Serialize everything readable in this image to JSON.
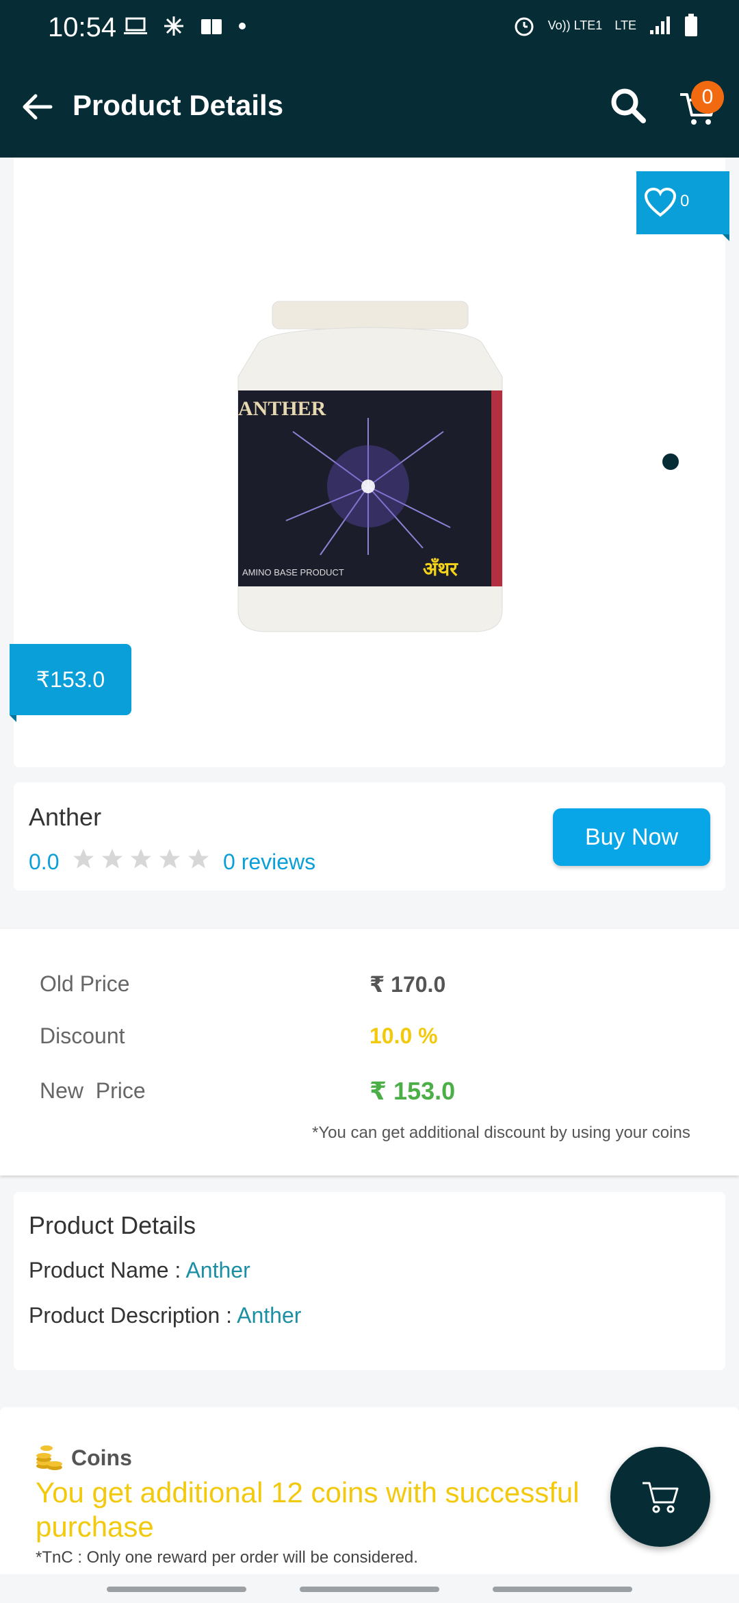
{
  "status_bar": {
    "time": "10:54",
    "network": "Vo)) LTE1",
    "network2": "LTE"
  },
  "app_bar": {
    "title": "Product Details",
    "cart_count": "0"
  },
  "product": {
    "wishlist_count": "0",
    "price_tag": "₹153.0",
    "name": "Anther",
    "rating": "0.0",
    "reviews": "0 reviews",
    "buy_now": "Buy Now",
    "image_label": "ANTHER",
    "image_sub": "AMINO BASE PRODUCT",
    "image_hindi": "अँथर"
  },
  "pricing": {
    "old_price_label": "Old Price",
    "old_price": "₹ 170.0",
    "discount_label": "Discount",
    "discount": "10.0 %",
    "new_price_label": "New  Price",
    "new_price": "₹ 153.0",
    "note": "*You can get additional discount by using your coins"
  },
  "details": {
    "title": "Product Details",
    "name_label": "Product Name : ",
    "name_value": "Anther",
    "desc_label": "Product Description : ",
    "desc_value": "Anther"
  },
  "coins": {
    "title": "Coins",
    "message": "You get additional 12 coins with successful purchase",
    "tnc": "*TnC : Only one reward per order will be considered."
  },
  "colors": {
    "primary": "#062c35",
    "accent": "#0a9fd8",
    "orange": "#f26a10",
    "yellow": "#f3c90e",
    "green": "#4cae46"
  }
}
